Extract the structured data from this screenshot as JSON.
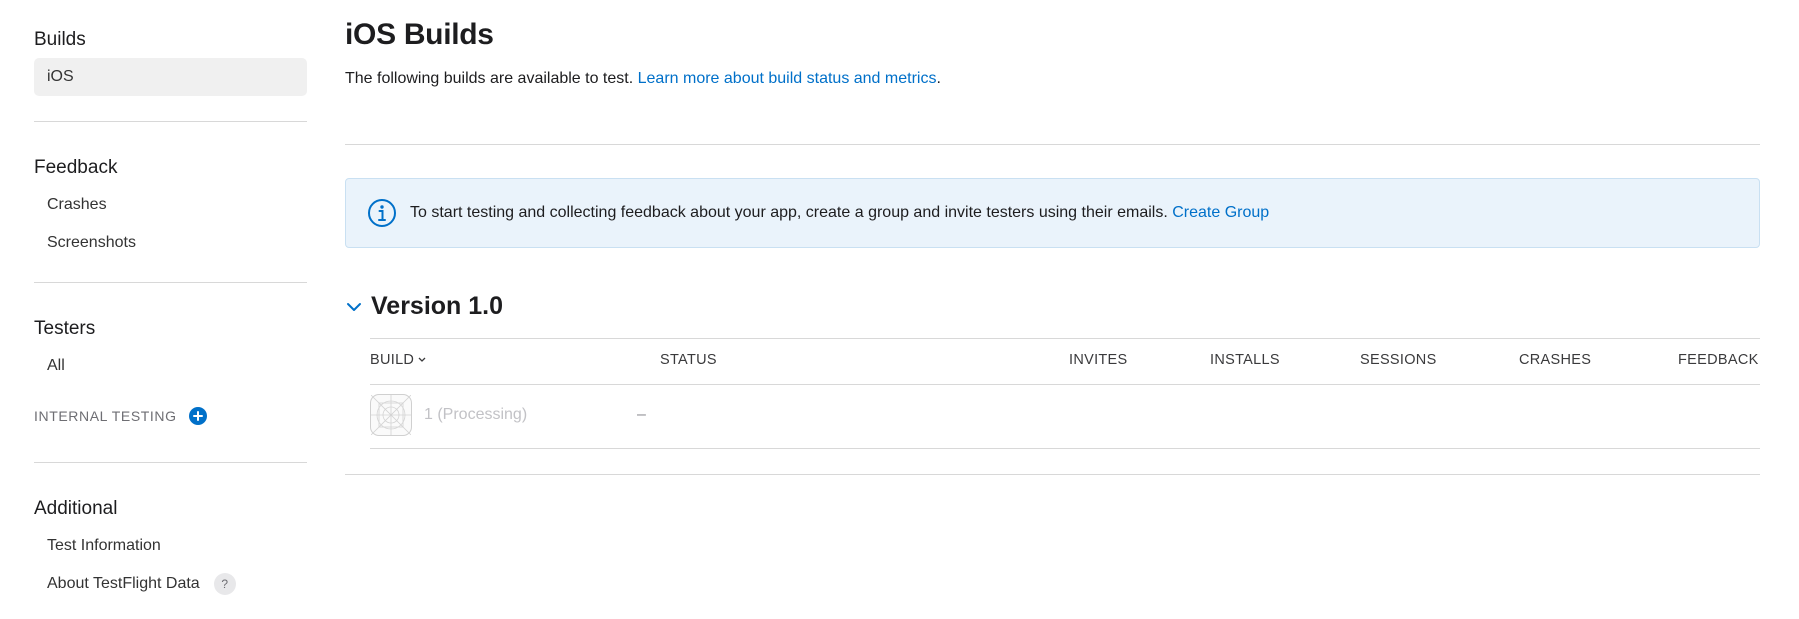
{
  "sidebar": {
    "builds": {
      "title": "Builds",
      "items": [
        {
          "label": "iOS",
          "active": true
        }
      ]
    },
    "feedback": {
      "title": "Feedback",
      "items": [
        {
          "label": "Crashes"
        },
        {
          "label": "Screenshots"
        }
      ]
    },
    "testers": {
      "title": "Testers",
      "items": [
        {
          "label": "All"
        }
      ],
      "internal_testing_label": "INTERNAL TESTING",
      "add_icon": "plus-circle-icon"
    },
    "additional": {
      "title": "Additional",
      "items": [
        {
          "label": "Test Information"
        },
        {
          "label": "About TestFlight Data",
          "help_glyph": "?"
        }
      ]
    }
  },
  "main": {
    "title": "iOS Builds",
    "subtitle": "The following builds are available to test.",
    "subtitle_link": "Learn more about build status and metrics",
    "subtitle_period": ".",
    "banner": {
      "icon": "info-circle-icon",
      "text": "To start testing and collecting feedback about your app, create a group and invite testers using their emails.",
      "link": "Create Group"
    },
    "version": {
      "title": "Version 1.0",
      "columns": {
        "build": "BUILD",
        "status": "STATUS",
        "invites": "INVITES",
        "installs": "INSTALLS",
        "sessions": "SESSIONS",
        "crashes": "CRASHES",
        "feedback": "FEEDBACK"
      },
      "rows": [
        {
          "build": "1 (Processing)",
          "status": "–"
        }
      ]
    }
  },
  "colors": {
    "link": "#0070c9",
    "banner_bg": "#eaf3fb",
    "active_nav_bg": "#f0f0f0"
  }
}
